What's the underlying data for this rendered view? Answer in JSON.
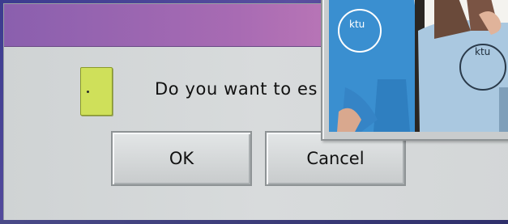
{
  "dialog": {
    "title": "",
    "message": "Do you want to es",
    "ok_label": "OK",
    "cancel_label": "Cancel"
  },
  "photo": {
    "shirt_text_left": "ktu",
    "shirt_text_right": "ktu"
  },
  "colors": {
    "titlebar_start": "#8a5fae",
    "titlebar_end": "#c87fba",
    "dialog_bg": "#d3d6d7",
    "icon_fill": "#cfe05a",
    "shirt_blue": "#3a8fd0",
    "shirt_light_blue": "#aac8e0"
  }
}
